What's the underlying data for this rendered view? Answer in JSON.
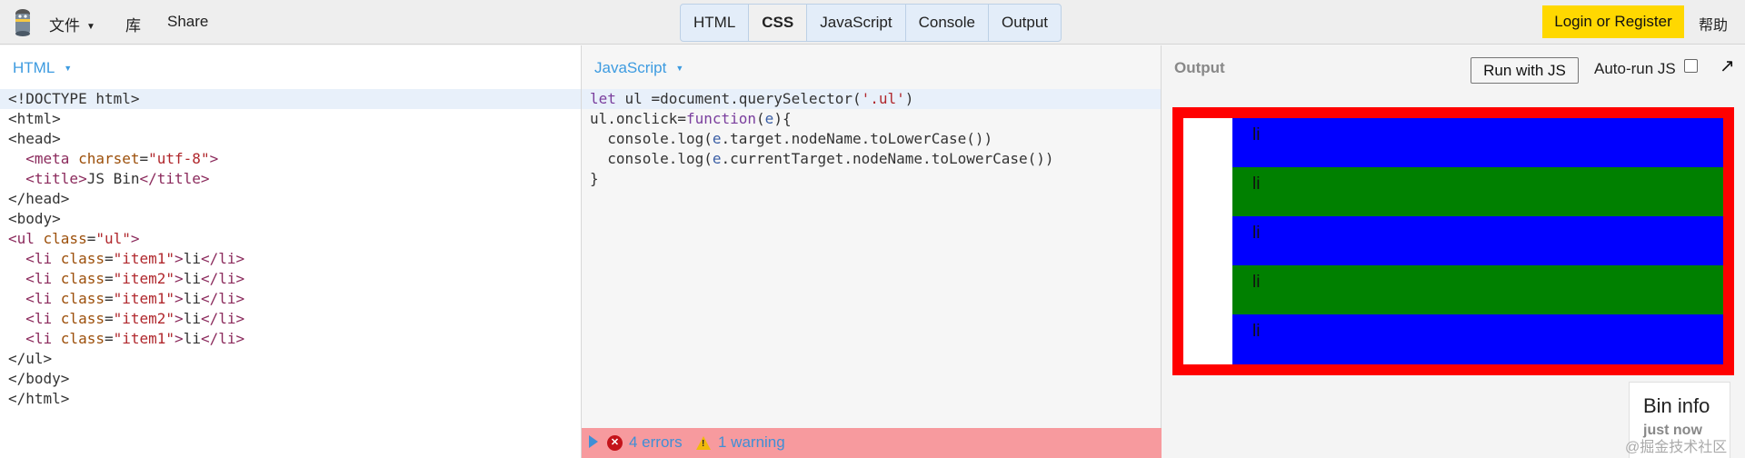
{
  "topbar": {
    "menu": [
      {
        "label": "文件",
        "has_caret": true
      },
      {
        "label": "库"
      },
      {
        "label": "Share"
      }
    ],
    "tabs": [
      {
        "label": "HTML",
        "active": false
      },
      {
        "label": "CSS",
        "active": true
      },
      {
        "label": "JavaScript",
        "active": false
      },
      {
        "label": "Console",
        "active": false
      },
      {
        "label": "Output",
        "active": false
      }
    ],
    "login_label": "Login or Register",
    "help_label": "帮助"
  },
  "html_panel": {
    "title": "HTML",
    "lines": [
      "<!DOCTYPE html>",
      "<html>",
      "<head>",
      "  <meta charset=\"utf-8\">",
      "  <title>JS Bin</title>",
      "</head>",
      "<body>",
      "<ul class=\"ul\">",
      "  <li class=\"item1\">li</li>",
      "  <li class=\"item2\">li</li>",
      "  <li class=\"item1\">li</li>",
      "  <li class=\"item2\">li</li>",
      "  <li class=\"item1\">li</li>",
      "</ul>",
      "</body>",
      "</html>"
    ]
  },
  "js_panel": {
    "title": "JavaScript",
    "lines": [
      "let ul =document.querySelector('.ul')",
      "ul.onclick=function(e){",
      "  console.log(e.target.nodeName.toLowerCase())",
      "  console.log(e.currentTarget.nodeName.toLowerCase())",
      "}"
    ],
    "errors_label": "4 errors",
    "warnings_label": "1 warning"
  },
  "output_panel": {
    "title": "Output",
    "run_label": "Run with JS",
    "autorun_label": "Auto-run JS",
    "autorun_checked": false,
    "list_items": [
      {
        "text": "li",
        "color": "#0000ff"
      },
      {
        "text": "li",
        "color": "#008000"
      },
      {
        "text": "li",
        "color": "#0000ff"
      },
      {
        "text": "li",
        "color": "#008000"
      },
      {
        "text": "li",
        "color": "#0000ff"
      }
    ],
    "border_color": "#ff0000",
    "bin_info_title": "Bin info",
    "bin_info_sub": "just now"
  },
  "watermark": "@掘金技术社区",
  "colors": {
    "accent": "#3d9be0",
    "login_bg": "#ffd800",
    "error_bar": "#f79a9e"
  }
}
